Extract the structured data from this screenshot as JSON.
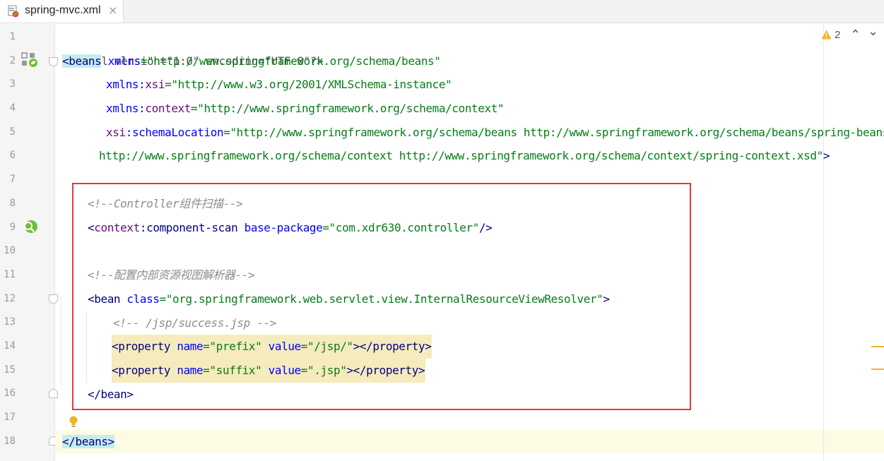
{
  "tab": {
    "filename": "spring-mvc.xml",
    "close_glyph": "×",
    "icon": "xml-file-icon"
  },
  "inspection": {
    "warning_count": "2",
    "up_glyph": "⌃",
    "down_glyph": "⌄"
  },
  "line_numbers": [
    "1",
    "2",
    "3",
    "4",
    "5",
    "6",
    "7",
    "8",
    "9",
    "10",
    "11",
    "12",
    "13",
    "14",
    "15",
    "16",
    "17",
    "18"
  ],
  "code": {
    "l1": {
      "pi": "<?xml version=\"1.0\" encoding=\"UTF-8\"?>"
    },
    "l2": {
      "open": "<",
      "tag": "beans",
      "attr": " xmlns",
      "eq": "=",
      "val": "\"http://www.springframework.org/schema/beans\""
    },
    "l3": {
      "attr": "xmlns",
      "colon": ":",
      "ns": "xsi",
      "eq": "=",
      "val": "\"http://www.w3.org/2001/XMLSchema-instance\""
    },
    "l4": {
      "attr": "xmlns",
      "colon": ":",
      "ns": "context",
      "eq": "=",
      "val": "\"http://www.springframework.org/schema/context\""
    },
    "l5": {
      "ns": "xsi",
      "colon": ":",
      "attr": "schemaLocation",
      "eq": "=",
      "val": "\"http://www.springframework.org/schema/beans http://www.springframework.org/schema/beans/spring-beans.xs"
    },
    "l6": {
      "val": "http://www.springframework.org/schema/context http://www.springframework.org/schema/context/spring-context.xsd\"",
      "close": ">"
    },
    "l8": {
      "comment": "<!--Controller组件扫描-->"
    },
    "l9": {
      "open": "<",
      "ns": "context",
      "colon": ":",
      "tag": "component-scan",
      "attr": " base-package",
      "eq": "=",
      "val": "\"com.xdr630.controller\"",
      "close": "/>"
    },
    "l11": {
      "comment": "<!--配置内部资源视图解析器-->"
    },
    "l12": {
      "open": "<",
      "tag": "bean",
      "attr": " class",
      "eq": "=",
      "val": "\"org.springframework.web.servlet.view.InternalResourceViewResolver\"",
      "close": ">"
    },
    "l13": {
      "comment": "<!-- /jsp/success.jsp -->"
    },
    "l14": {
      "open": "<",
      "tag": "property",
      "attr1": " name",
      "eq1": "=",
      "val1": "\"prefix\"",
      "attr2": " value",
      "eq2": "=",
      "val2": "\"/jsp/\"",
      "mid": "></",
      "tag2": "property",
      "close": ">"
    },
    "l15": {
      "open": "<",
      "tag": "property",
      "attr1": " name",
      "eq1": "=",
      "val1": "\"suffix\"",
      "attr2": " value",
      "eq2": "=",
      "val2": "\".jsp\"",
      "mid": "></",
      "tag2": "property",
      "close": ">"
    },
    "l16": {
      "open": "</",
      "tag": "bean",
      "close": ">"
    },
    "l18": {
      "open": "</",
      "tag": "beans",
      "close": ">"
    }
  },
  "colors": {
    "tag": "#000080",
    "attr": "#0000ff",
    "namespace": "#660e7a",
    "value": "#067d17",
    "comment": "#8c8c8c",
    "annotation_box": "#e53935",
    "warning": "#f0b429"
  }
}
